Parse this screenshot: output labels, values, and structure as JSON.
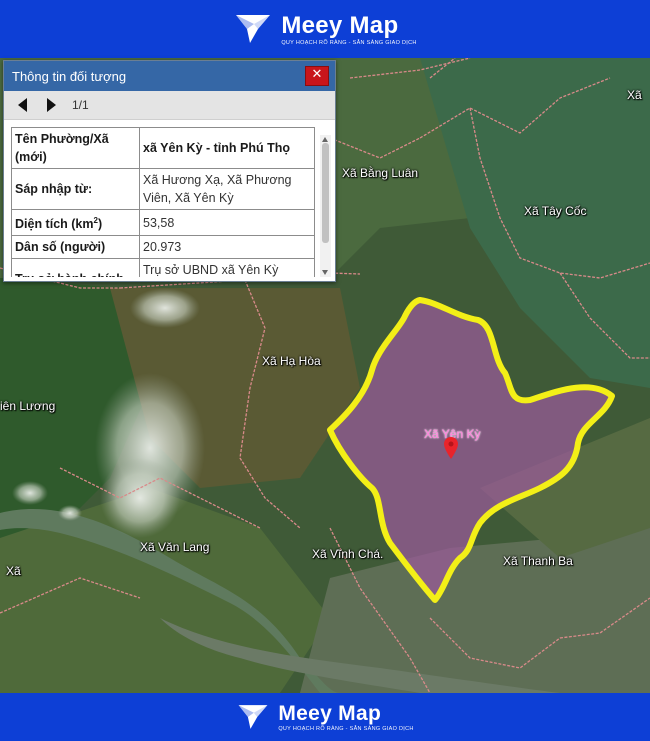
{
  "brand": {
    "name": "Meey Map",
    "tagline": "QUY HOẠCH RÕ RÀNG - SẴN SÀNG GIAO DỊCH"
  },
  "panel": {
    "title": "Thông tin đối tượng",
    "close_label": "✕",
    "page_indicator": "1/1",
    "rows": [
      {
        "key": "Tên Phường/Xã (mới)",
        "value": "xã Yên Kỳ - tỉnh Phú Thọ"
      },
      {
        "key": "Sáp nhập từ:",
        "value": "Xã Hương Xạ, Xã Phương Viên, Xã Yên Kỳ"
      },
      {
        "key": "Diện tích (km²)",
        "value": "53,58"
      },
      {
        "key": "Dân số (người)",
        "value": "20.973"
      },
      {
        "key": "Trụ sở hành chính",
        "value": "Trụ sở UBND xã Yên Kỳ trước sáp nhập"
      }
    ],
    "area_key_base": "Diện tích (km",
    "area_key_sup": "2",
    "area_key_end": ")"
  },
  "map": {
    "selected_label": "Xã Yên Kỳ",
    "labels": [
      {
        "id": "xa-bang-luan",
        "text": "Xã Bằng Luân"
      },
      {
        "id": "xa-tay-coc",
        "text": "Xã Tây Cốc"
      },
      {
        "id": "xa-ha-hoa",
        "text": "Xã Hạ Hòa"
      },
      {
        "id": "xa-lien-luong-partial",
        "text": "iên Lương"
      },
      {
        "id": "xa-van-lang",
        "text": "Xã Văn Lang"
      },
      {
        "id": "xa-vinh-chan",
        "text": "Xã Vĩnh Chá."
      },
      {
        "id": "xa-thanh-ba",
        "text": "Xã Thanh Ba"
      },
      {
        "id": "xa-top-right-partial",
        "text": "Xã"
      },
      {
        "id": "xa-bottom-left-partial",
        "text": "Xã"
      }
    ],
    "colors": {
      "selected_outline": "#f3ef17",
      "selected_fill": "#9b5a9b",
      "boundary": "#d98a8a",
      "panel_header": "#3567a6",
      "banner": "#0d3fd6"
    }
  }
}
